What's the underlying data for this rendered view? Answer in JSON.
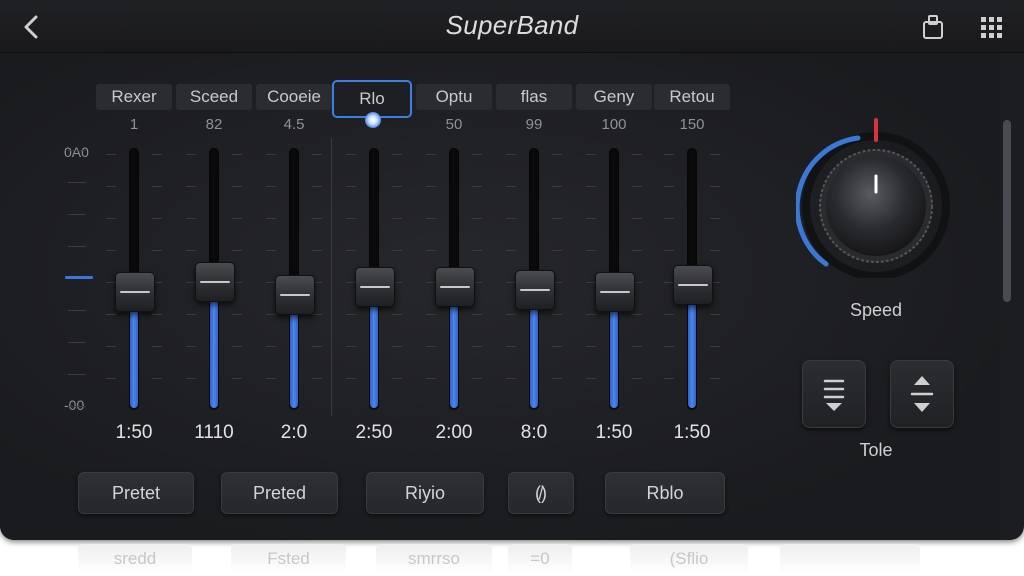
{
  "header": {
    "title": "SuperBand",
    "back_icon": "chevron-left-icon",
    "share_icon": "share-icon",
    "menu_icon": "grid-menu-icon"
  },
  "scale": {
    "top": "0A0",
    "bottom": "-00"
  },
  "bands": [
    {
      "label": "Rexer",
      "value": "1",
      "time": "1:50",
      "level": 0.46
    },
    {
      "label": "Sceed",
      "value": "82",
      "time": "1110",
      "level": 0.5
    },
    {
      "label": "Cooeie",
      "value": "4.5",
      "time": "2:0",
      "level": 0.45
    },
    {
      "label": "Rlo",
      "value": "",
      "time": "2:50",
      "level": 0.48,
      "selected": true
    },
    {
      "label": "Optu",
      "value": "50",
      "time": "2:00",
      "level": 0.48
    },
    {
      "label": "flas",
      "value": "99",
      "time": "8:0",
      "level": 0.47
    },
    {
      "label": "Geny",
      "value": "100",
      "time": "1:50",
      "level": 0.46
    },
    {
      "label": "Retou",
      "value": "150",
      "time": "1:50",
      "level": 0.49
    }
  ],
  "buttons": [
    "Pretet",
    "Preted",
    "Riyio",
    "(̸)",
    "Rblo"
  ],
  "speed": {
    "label": "Speed",
    "level": 0.5,
    "accent": "#3a78d8",
    "marker": "#d6333a"
  },
  "tone": {
    "label": "Tole",
    "icons": [
      "lines-chevron-down-icon",
      "chevrons-up-down-icon"
    ]
  },
  "ghost_buttons": [
    "sredd",
    "Fsted",
    "smrrso",
    "=0",
    "(Sflio"
  ],
  "colors": {
    "accent": "#3b7fe0",
    "panel": "#1c1d20",
    "text": "#e2e2e4"
  }
}
